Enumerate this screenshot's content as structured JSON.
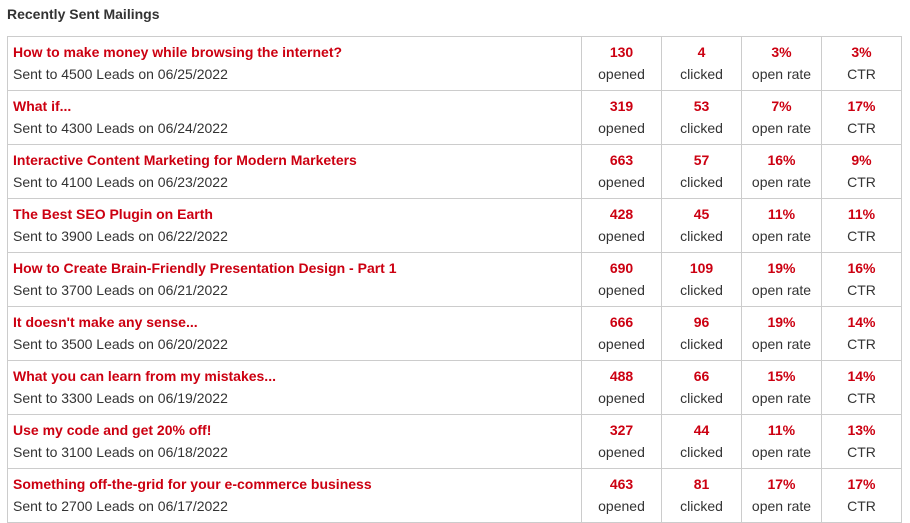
{
  "header": {
    "title": "Recently Sent Mailings"
  },
  "colors": {
    "accent": "#cc0011",
    "text": "#333333",
    "border": "#cccccc"
  },
  "labels": {
    "opened": "opened",
    "clicked": "clicked",
    "open_rate": "open rate",
    "ctr": "CTR"
  },
  "mailings": [
    {
      "subject": "How to make money while browsing the internet?",
      "sent": "Sent to 4500 Leads on 06/25/2022",
      "opened": "130",
      "clicked": "4",
      "open_rate": "3%",
      "ctr": "3%"
    },
    {
      "subject": "What if...",
      "sent": "Sent to 4300 Leads on 06/24/2022",
      "opened": "319",
      "clicked": "53",
      "open_rate": "7%",
      "ctr": "17%"
    },
    {
      "subject": "Interactive Content Marketing for Modern Marketers",
      "sent": "Sent to 4100 Leads on 06/23/2022",
      "opened": "663",
      "clicked": "57",
      "open_rate": "16%",
      "ctr": "9%"
    },
    {
      "subject": "The Best SEO Plugin on Earth",
      "sent": "Sent to 3900 Leads on 06/22/2022",
      "opened": "428",
      "clicked": "45",
      "open_rate": "11%",
      "ctr": "11%"
    },
    {
      "subject": "How to Create Brain-Friendly Presentation Design - Part 1",
      "sent": "Sent to 3700 Leads on 06/21/2022",
      "opened": "690",
      "clicked": "109",
      "open_rate": "19%",
      "ctr": "16%"
    },
    {
      "subject": "It doesn't make any sense...",
      "sent": "Sent to 3500 Leads on 06/20/2022",
      "opened": "666",
      "clicked": "96",
      "open_rate": "19%",
      "ctr": "14%"
    },
    {
      "subject": "What you can learn from my mistakes...",
      "sent": "Sent to 3300 Leads on 06/19/2022",
      "opened": "488",
      "clicked": "66",
      "open_rate": "15%",
      "ctr": "14%"
    },
    {
      "subject": "Use my code and get 20% off!",
      "sent": "Sent to 3100 Leads on 06/18/2022",
      "opened": "327",
      "clicked": "44",
      "open_rate": "11%",
      "ctr": "13%"
    },
    {
      "subject": "Something off-the-grid for your e-commerce business",
      "sent": "Sent to 2700 Leads on 06/17/2022",
      "opened": "463",
      "clicked": "81",
      "open_rate": "17%",
      "ctr": "17%"
    }
  ]
}
